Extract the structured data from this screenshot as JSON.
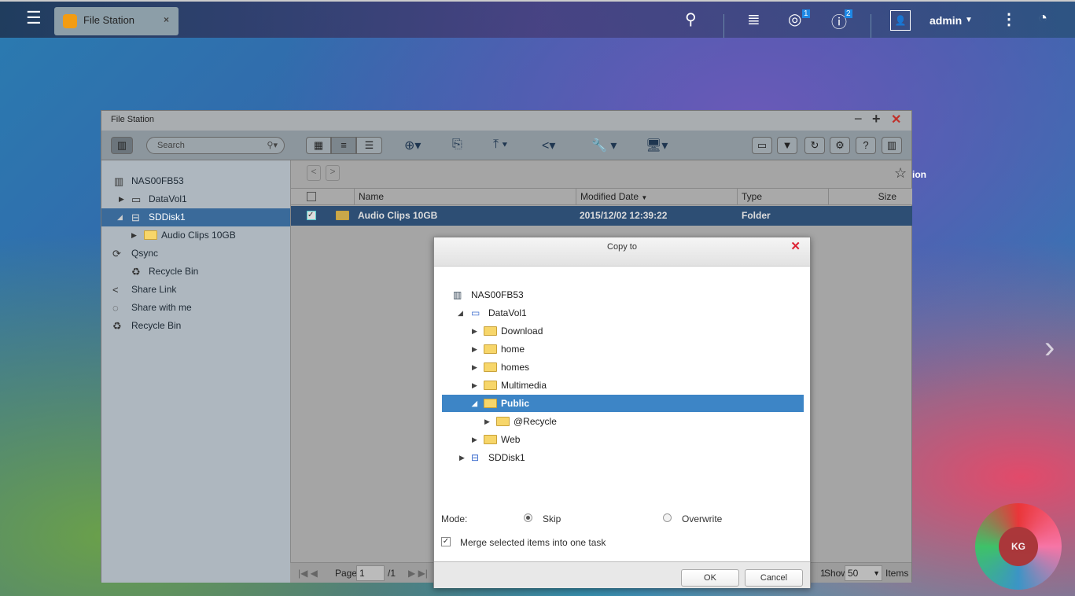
{
  "topbar": {
    "tab_label": "File Station",
    "user": "admin",
    "notif_badge": "1",
    "info_badge": "2"
  },
  "window": {
    "title": "File Station",
    "search_placeholder": "Search"
  },
  "sidebar": {
    "items": [
      "NAS00FB53",
      "DataVol1",
      "SDDisk1",
      "Audio Clips 10GB",
      "Qsync",
      "Recycle Bin",
      "Share Link",
      "Share with me",
      "Recycle Bin"
    ]
  },
  "table": {
    "columns": [
      "Name",
      "Modified Date",
      "Type",
      "Size"
    ],
    "rows": [
      {
        "name": "Audio Clips 10GB",
        "modified": "2015/12/02 12:39:22",
        "type": "Folder",
        "size": ""
      }
    ]
  },
  "pager": {
    "page_label": "Page",
    "page": "1",
    "total": "/1",
    "total_right": "1",
    "show_label": "Show",
    "show_value": "50",
    "items_label": "Items"
  },
  "dialog": {
    "title": "Copy to",
    "tree": [
      "NAS00FB53",
      "DataVol1",
      "Download",
      "home",
      "homes",
      "Multimedia",
      "Public",
      "@Recycle",
      "Web",
      "SDDisk1"
    ],
    "mode_label": "Mode:",
    "skip": "Skip",
    "overwrite": "Overwrite",
    "merge": "Merge selected items into one task",
    "ok": "OK",
    "cancel": "Cancel"
  },
  "desktop": {
    "partial_label": "ion"
  }
}
